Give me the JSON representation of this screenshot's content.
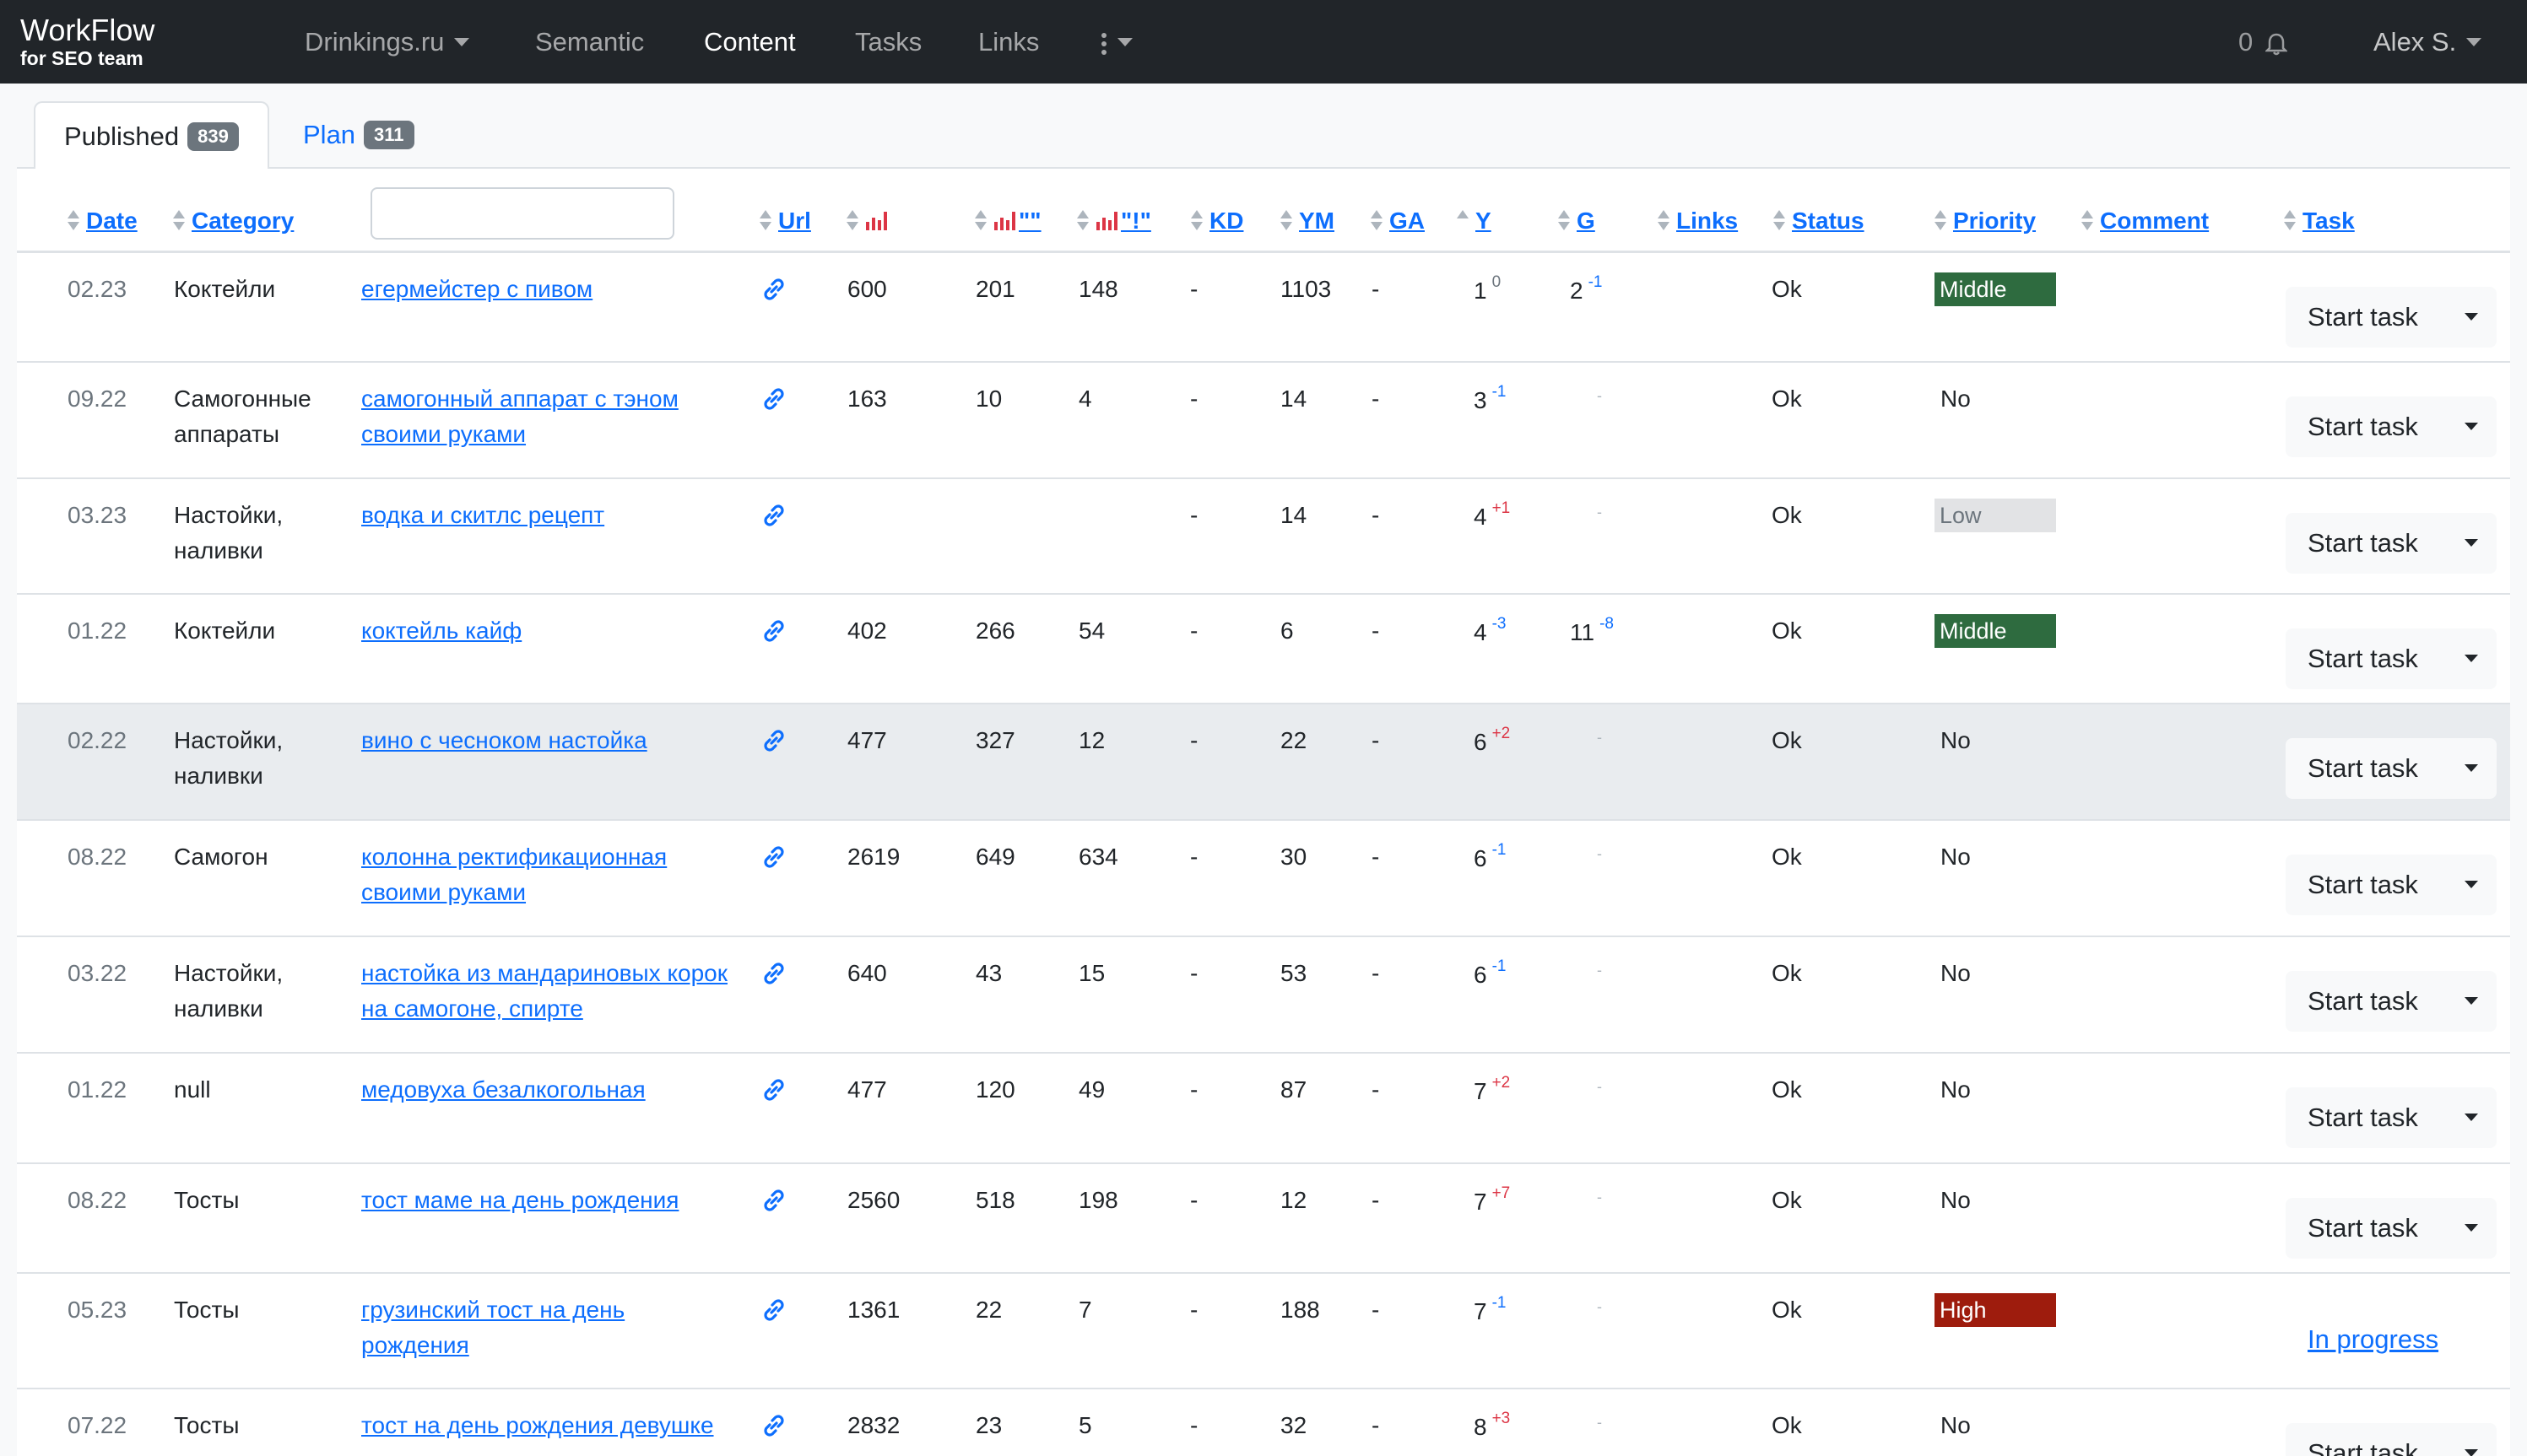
{
  "navbar": {
    "brand_title": "WorkFlow",
    "brand_subtitle": "for SEO team",
    "site_select": "Drinkings.ru",
    "items": [
      "Semantic",
      "Content",
      "Tasks",
      "Links"
    ],
    "active_item": "Content",
    "notifications_count": "0",
    "user": "Alex S."
  },
  "tabs": [
    {
      "label": "Published",
      "count": "839",
      "active": true
    },
    {
      "label": "Plan",
      "count": "311",
      "active": false
    }
  ],
  "columns": {
    "date": "Date",
    "category": "Category",
    "url": "Url",
    "f1": "\"\"",
    "f2": "\"!\"",
    "kd": "KD",
    "ym": "YM",
    "ga": "GA",
    "y": "Y",
    "g": "G",
    "links": "Links",
    "status": "Status",
    "priority": "Priority",
    "comment": "Comment",
    "task": "Task"
  },
  "filter": {
    "value": ""
  },
  "colors": {
    "navbar": "#212529",
    "link": "#0d6efd",
    "middle": "#2e6b3f",
    "low": "#e2e3e5",
    "high": "#9e1c0d",
    "freq_icon": "#dc3545"
  },
  "task_button_label": "Start task",
  "rows": [
    {
      "date": "02.23",
      "category": "Коктейли",
      "keyword": "егермейстер с пивом",
      "freq": "600",
      "freq_q": "201",
      "freq_qe": "148",
      "kd": "-",
      "ym": "1103",
      "ga": "-",
      "y": "1",
      "y_delta": "0",
      "g": "2",
      "g_delta": "-1",
      "status": "Ok",
      "priority": "Middle",
      "task": "Start task"
    },
    {
      "date": "09.22",
      "category": "Самогонные аппараты",
      "keyword": "самогонный аппарат с тэном своими руками",
      "freq": "163",
      "freq_q": "10",
      "freq_qe": "4",
      "kd": "-",
      "ym": "14",
      "ga": "-",
      "y": "3",
      "y_delta": "-1",
      "g": "-",
      "g_delta": "",
      "status": "Ok",
      "priority": "No",
      "task": "Start task"
    },
    {
      "date": "03.23",
      "category": "Настойки, наливки",
      "keyword": "водка и скитлс рецепт",
      "freq": "",
      "freq_q": "",
      "freq_qe": "",
      "kd": "-",
      "ym": "14",
      "ga": "-",
      "y": "4",
      "y_delta": "+1",
      "g": "-",
      "g_delta": "",
      "status": "Ok",
      "priority": "Low",
      "task": "Start task"
    },
    {
      "date": "01.22",
      "category": "Коктейли",
      "keyword": "коктейль кайф",
      "freq": "402",
      "freq_q": "266",
      "freq_qe": "54",
      "kd": "-",
      "ym": "6",
      "ga": "-",
      "y": "4",
      "y_delta": "-3",
      "g": "11",
      "g_delta": "-8",
      "status": "Ok",
      "priority": "Middle",
      "task": "Start task"
    },
    {
      "date": "02.22",
      "category": "Настойки, наливки",
      "keyword": "вино с чесноком настойка",
      "freq": "477",
      "freq_q": "327",
      "freq_qe": "12",
      "kd": "-",
      "ym": "22",
      "ga": "-",
      "y": "6",
      "y_delta": "+2",
      "g": "-",
      "g_delta": "",
      "status": "Ok",
      "priority": "No",
      "task": "Start task"
    },
    {
      "date": "08.22",
      "category": "Самогон",
      "keyword": "колонна ректификационная своими руками",
      "freq": "2619",
      "freq_q": "649",
      "freq_qe": "634",
      "kd": "-",
      "ym": "30",
      "ga": "-",
      "y": "6",
      "y_delta": "-1",
      "g": "-",
      "g_delta": "",
      "status": "Ok",
      "priority": "No",
      "task": "Start task"
    },
    {
      "date": "03.22",
      "category": "Настойки, наливки",
      "keyword": "настойка из мандариновых корок на самогоне, спирте",
      "freq": "640",
      "freq_q": "43",
      "freq_qe": "15",
      "kd": "-",
      "ym": "53",
      "ga": "-",
      "y": "6",
      "y_delta": "-1",
      "g": "-",
      "g_delta": "",
      "status": "Ok",
      "priority": "No",
      "task": "Start task"
    },
    {
      "date": "01.22",
      "category": "null",
      "keyword": "медовуха безалкогольная",
      "freq": "477",
      "freq_q": "120",
      "freq_qe": "49",
      "kd": "-",
      "ym": "87",
      "ga": "-",
      "y": "7",
      "y_delta": "+2",
      "g": "-",
      "g_delta": "",
      "status": "Ok",
      "priority": "No",
      "task": "Start task"
    },
    {
      "date": "08.22",
      "category": "Тосты",
      "keyword": "тост маме на день рождения",
      "freq": "2560",
      "freq_q": "518",
      "freq_qe": "198",
      "kd": "-",
      "ym": "12",
      "ga": "-",
      "y": "7",
      "y_delta": "+7",
      "g": "-",
      "g_delta": "",
      "status": "Ok",
      "priority": "No",
      "task": "Start task"
    },
    {
      "date": "05.23",
      "category": "Тосты",
      "keyword": "грузинский тост на день рождения",
      "freq": "1361",
      "freq_q": "22",
      "freq_qe": "7",
      "kd": "-",
      "ym": "188",
      "ga": "-",
      "y": "7",
      "y_delta": "-1",
      "g": "-",
      "g_delta": "",
      "status": "Ok",
      "priority": "High",
      "task": "In progress"
    },
    {
      "date": "07.22",
      "category": "Тосты",
      "keyword": "тост на день рождения девушке",
      "freq": "2832",
      "freq_q": "23",
      "freq_qe": "5",
      "kd": "-",
      "ym": "32",
      "ga": "-",
      "y": "8",
      "y_delta": "+3",
      "g": "-",
      "g_delta": "",
      "status": "Ok",
      "priority": "No",
      "task": "Start task"
    }
  ]
}
